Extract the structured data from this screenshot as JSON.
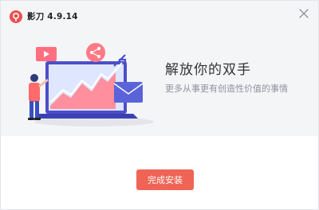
{
  "app": {
    "title": "影刀 4.9.14",
    "logo_icon": "ying-dao-logo-icon",
    "brand_color": "#ef4d4d"
  },
  "titlebar": {
    "close_icon": "close-icon"
  },
  "hero": {
    "headline": "解放你的双手",
    "subline": "更多从事更有创造性价值的事情",
    "illustration": "person-with-laptop-growth-chart-illustration"
  },
  "footer": {
    "finish_button_label": "完成安装",
    "button_color": "#f06456"
  }
}
